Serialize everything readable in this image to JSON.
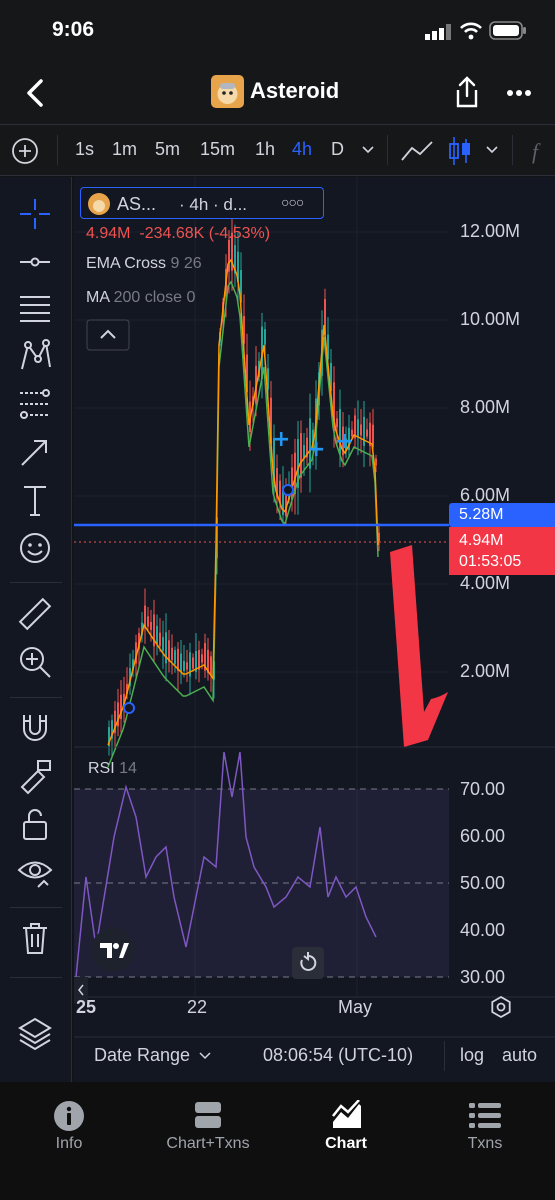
{
  "status_bar": {
    "time": "9:06"
  },
  "header": {
    "title": "Asteroid"
  },
  "timeframes": [
    "1s",
    "1m",
    "5m",
    "15m",
    "1h",
    "4h",
    "D"
  ],
  "active_timeframe": "4h",
  "legend": {
    "symbol": "AS...",
    "interval": "· 4h · d...",
    "more": "○○○",
    "close": "4.94M",
    "change": "-234.68K",
    "change_pct": "(-4.53%)",
    "ema_name": "EMA Cross",
    "ema_params": "9 26",
    "ma_name": "MA",
    "ma_params": "200 close 0"
  },
  "price_axis": [
    "12.00M",
    "10.00M",
    "8.00M",
    "6.00M",
    "4.00M",
    "2.00M"
  ],
  "price_tag_blue": "5.28M",
  "price_tag_red": "4.94M",
  "countdown": "01:53:05",
  "rsi": {
    "label": "RSI",
    "param": "14",
    "levels": [
      "70.00",
      "60.00",
      "50.00",
      "40.00",
      "30.00"
    ]
  },
  "time_axis": [
    "25",
    "22",
    "May"
  ],
  "chart_footer": {
    "date_range": "Date Range",
    "clock": "08:06:54 (UTC-10)",
    "log": "log",
    "auto": "auto"
  },
  "tabs": [
    {
      "label": "Info",
      "icon": "info-icon"
    },
    {
      "label": "Chart+Txns",
      "icon": "split-view-icon"
    },
    {
      "label": "Chart",
      "icon": "chart-icon"
    },
    {
      "label": "Txns",
      "icon": "list-icon"
    }
  ],
  "active_tab": "Chart",
  "colors": {
    "up": "#26a69a",
    "down": "#ef5350",
    "accent": "#2962ff",
    "rsi": "#7e57c2",
    "annotation": "#f23645"
  }
}
